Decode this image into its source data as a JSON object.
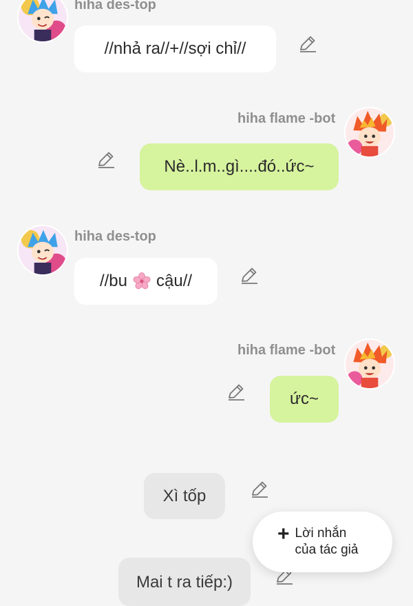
{
  "messages": [
    {
      "sender": "hiha des-top",
      "text": "//nhả ra//+//sợi chỉ//"
    },
    {
      "sender": "hiha flame -bot",
      "text": "Nè..l.m..gì....đó..ức~"
    },
    {
      "sender": "hiha des-top",
      "text_before": "//bu",
      "text_after": "cậu//",
      "emoji": "cherry-blossom"
    },
    {
      "sender": "hiha flame -bot",
      "text": "ức~"
    },
    {
      "sender": "",
      "text": "Xì tốp"
    },
    {
      "sender": "",
      "text": "Mai t ra tiếp:)"
    }
  ],
  "fab": {
    "icon": "plus-icon",
    "label": "Lời nhắn\ncủa tác giả"
  },
  "colors": {
    "background": "#f5f5f5",
    "incoming_bubble": "#ffffff",
    "outgoing_bubble": "#d6f39e",
    "narration_bubble": "#e7e7e7",
    "sender_name": "#8f8f8f"
  }
}
